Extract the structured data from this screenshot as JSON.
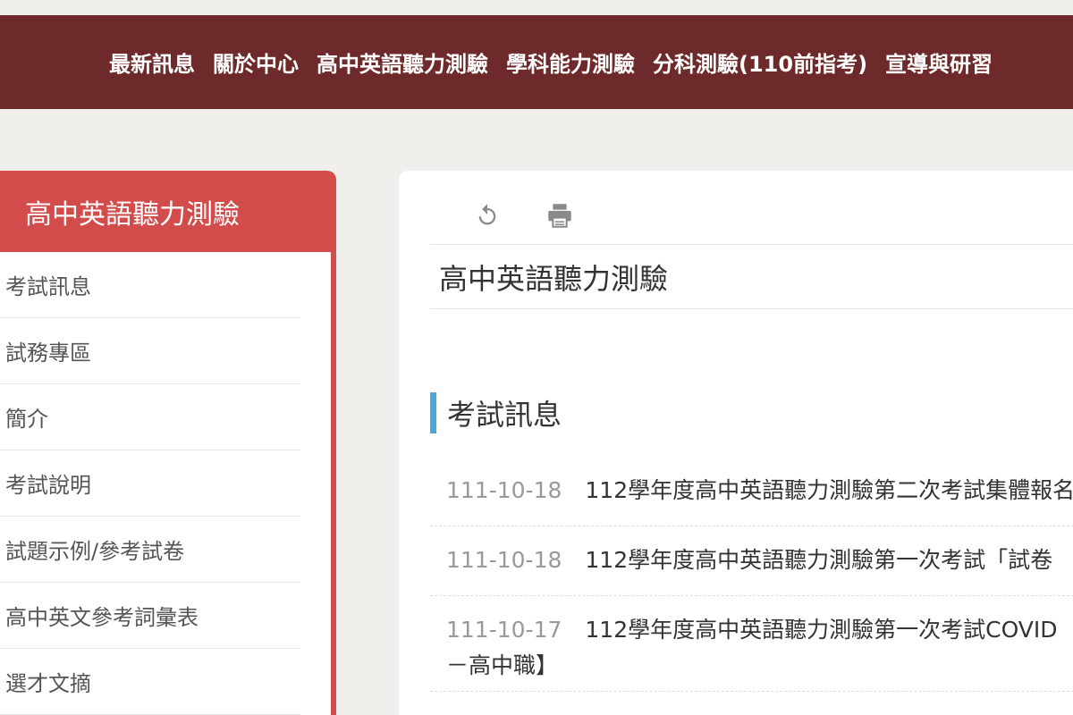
{
  "topnav": {
    "items": [
      "最新訊息",
      "關於中心",
      "高中英語聽力測驗",
      "學科能力測驗",
      "分科測驗(110前指考)",
      "宣導與研習"
    ]
  },
  "sidebar": {
    "header": "高中英語聽力測驗",
    "items": [
      {
        "label": "考試訊息"
      },
      {
        "label": "試務專區"
      },
      {
        "label": "簡介"
      },
      {
        "label": "考試說明"
      },
      {
        "label": "試題示例/參考試卷"
      },
      {
        "label": "高中英文參考詞彙表"
      },
      {
        "label": "選才文摘"
      }
    ],
    "accent_color": "#d24c4c"
  },
  "toolbar": {
    "icons": [
      "reload-icon",
      "print-icon"
    ]
  },
  "main": {
    "page_title": "高中英語聽力測驗",
    "section_heading": "考試訊息",
    "news": [
      {
        "date": "111-10-18",
        "title": "112學年度高中英語聽力測驗第二次考試集體報名"
      },
      {
        "date": "111-10-18",
        "title": "112學年度高中英語聽力測驗第一次考試「試卷"
      },
      {
        "date": "111-10-17",
        "title": "112學年度高中英語聽力測驗第一次考試COVID",
        "continuation": "－高中職】"
      }
    ]
  },
  "colors": {
    "topnav_bg": "#6e2a2a",
    "sidebar_accent": "#d24c4c",
    "section_bar": "#4aa8d8"
  }
}
